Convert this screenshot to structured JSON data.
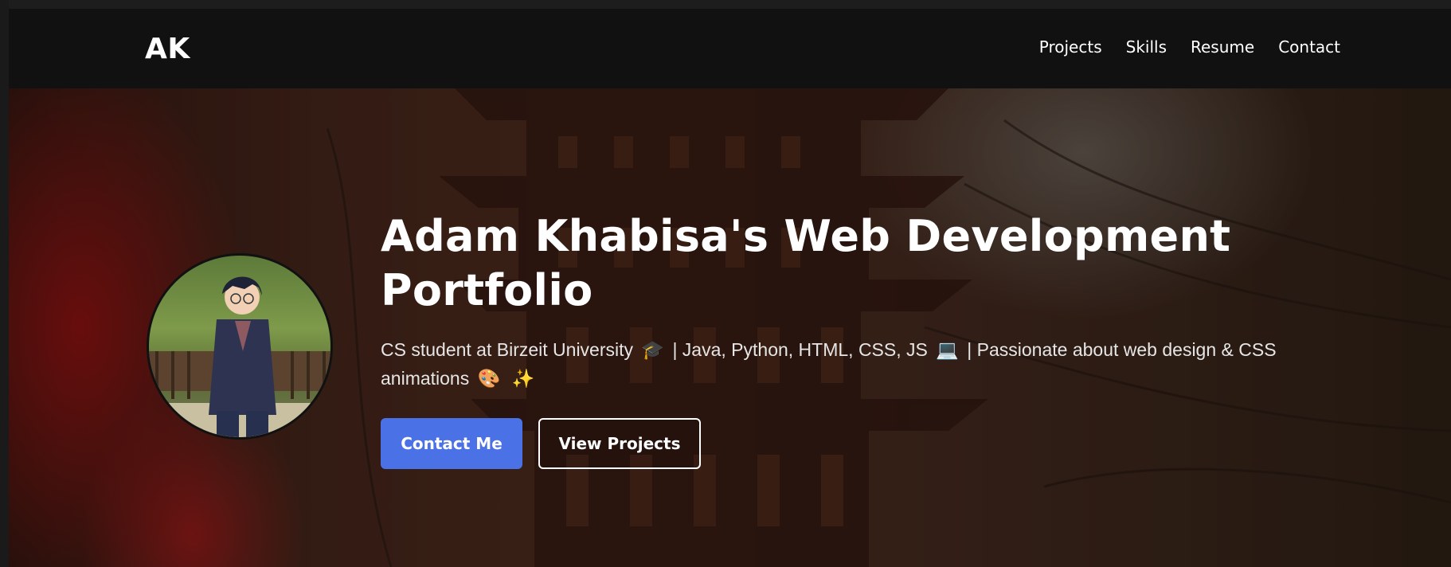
{
  "brand": {
    "logo_text": "AK"
  },
  "nav": {
    "items": [
      {
        "label": "Projects"
      },
      {
        "label": "Skills"
      },
      {
        "label": "Resume"
      },
      {
        "label": "Contact"
      }
    ]
  },
  "hero": {
    "title": "Adam Khabisa's Web Development Portfolio",
    "subtitle_part1": "CS student at Birzeit University",
    "emoji_1": "🎓",
    "subtitle_part2": "| Java, Python, HTML, CSS, JS",
    "emoji_2": "💻",
    "subtitle_part3": "| Passionate about web design & CSS animations",
    "emoji_3": "🎨",
    "emoji_4": "✨",
    "primary_button": "Contact Me",
    "secondary_button": "View Projects"
  },
  "colors": {
    "navbar_bg": "#111111",
    "primary_button": "#4a72e6",
    "text": "#ffffff"
  }
}
